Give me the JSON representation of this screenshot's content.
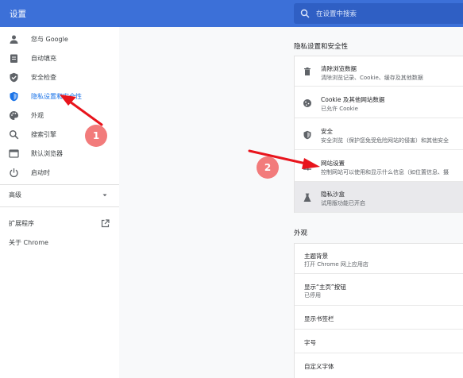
{
  "header": {
    "title": "设置",
    "search_placeholder": "在设置中搜索",
    "brand_color": "#3c70d8"
  },
  "sidebar": {
    "items": [
      {
        "label": "您与 Google",
        "icon": "person-icon"
      },
      {
        "label": "自动填充",
        "icon": "clipboard-icon"
      },
      {
        "label": "安全检查",
        "icon": "shield-check-icon"
      },
      {
        "label": "隐私设置和安全性",
        "icon": "shield-icon",
        "active": true
      },
      {
        "label": "外观",
        "icon": "palette-icon"
      },
      {
        "label": "搜索引擎",
        "icon": "search-icon"
      },
      {
        "label": "默认浏览器",
        "icon": "browser-icon"
      },
      {
        "label": "启动时",
        "icon": "power-icon"
      }
    ],
    "advanced_label": "高级",
    "extensions_label": "扩展程序",
    "about_label": "关于 Chrome"
  },
  "privacy": {
    "title": "隐私设置和安全性",
    "rows": [
      {
        "title": "清除浏览数据",
        "subtitle": "清除浏览记录、Cookie、缓存及其他数据",
        "icon": "trash-icon"
      },
      {
        "title": "Cookie 及其他网站数据",
        "subtitle": "已允许 Cookie",
        "icon": "cookie-icon"
      },
      {
        "title": "安全",
        "subtitle": "安全浏览（保护您免受危险网站的侵害）和其他安全",
        "icon": "shield-icon"
      },
      {
        "title": "网站设置",
        "subtitle": "控制网站可以使用和显示什么信息（如位置信息、摄",
        "icon": "sliders-icon"
      },
      {
        "title": "隐私沙盒",
        "subtitle": "试用版功能已开启",
        "icon": "flask-icon",
        "highlighted": true
      }
    ]
  },
  "appearance": {
    "title": "外观",
    "rows": [
      {
        "title": "主题背景",
        "subtitle": "打开 Chrome 网上应用店"
      },
      {
        "title": "显示“主页”按钮",
        "subtitle": "已停用"
      },
      {
        "title": "显示书签栏",
        "subtitle": ""
      },
      {
        "title": "字号",
        "subtitle": ""
      },
      {
        "title": "自定义字体",
        "subtitle": ""
      }
    ]
  },
  "annotations": {
    "badges": [
      "1",
      "2"
    ],
    "arrow_color": "#e8141c",
    "badge_color": "#f27b7b"
  }
}
